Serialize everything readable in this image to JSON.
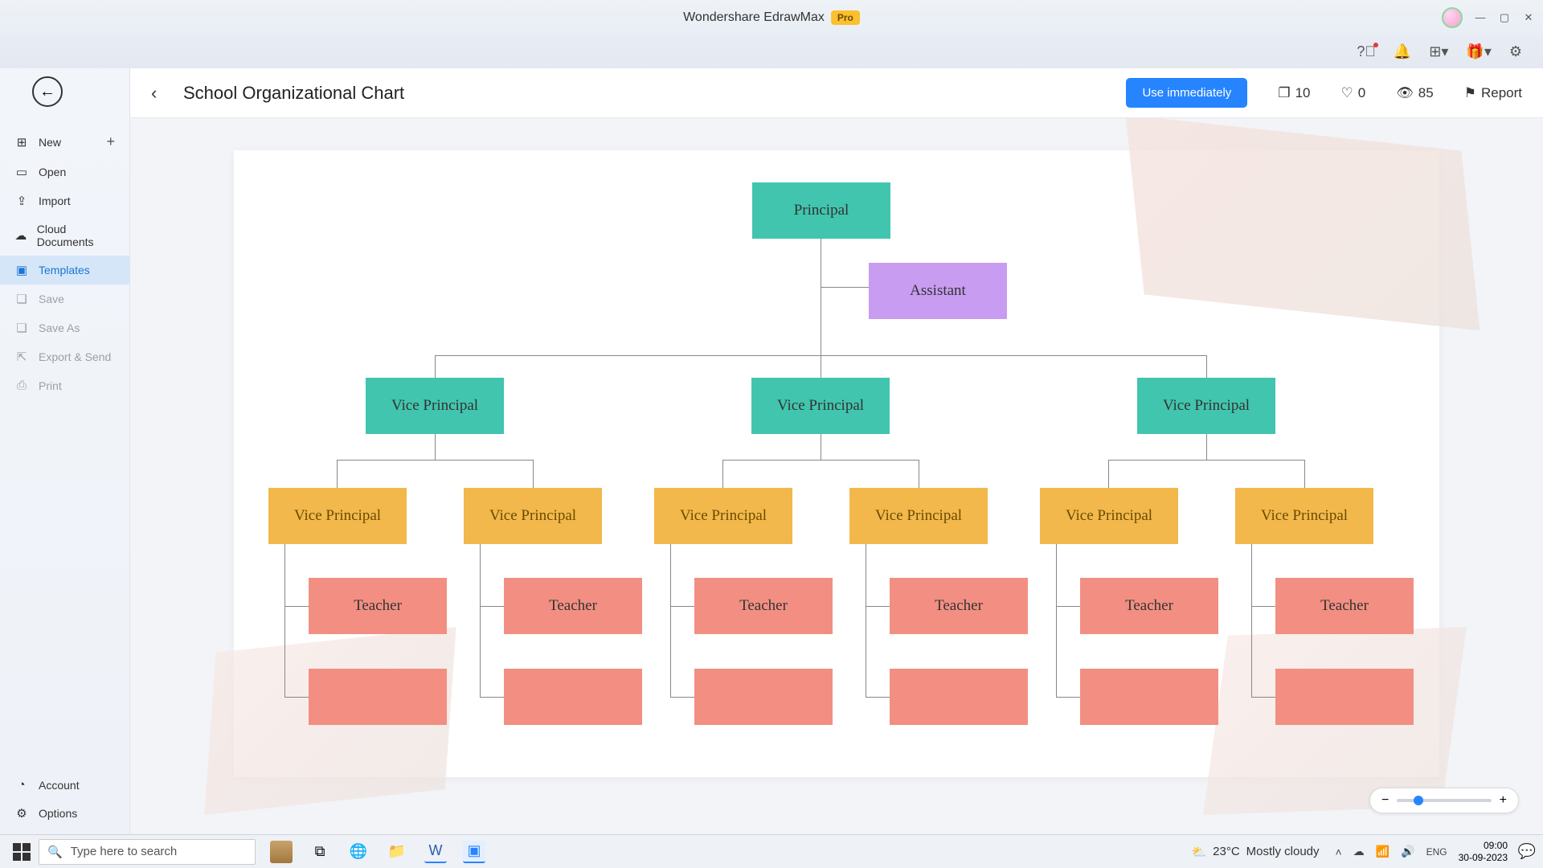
{
  "titlebar": {
    "app": "Wondershare EdrawMax",
    "badge": "Pro"
  },
  "sidebar": {
    "items": [
      {
        "label": "New",
        "icon": "⊞",
        "plus": true
      },
      {
        "label": "Open",
        "icon": "▭"
      },
      {
        "label": "Import",
        "icon": "⇪"
      },
      {
        "label": "Cloud Documents",
        "icon": "☁"
      },
      {
        "label": "Templates",
        "icon": "▣",
        "selected": true
      },
      {
        "label": "Save",
        "icon": "❏",
        "disabled": true
      },
      {
        "label": "Save As",
        "icon": "❏",
        "disabled": true
      },
      {
        "label": "Export & Send",
        "icon": "⇱",
        "disabled": true
      },
      {
        "label": "Print",
        "icon": "⎙",
        "disabled": true
      }
    ],
    "bottom": [
      {
        "label": "Account",
        "icon": "◔"
      },
      {
        "label": "Options",
        "icon": "⚙"
      }
    ]
  },
  "toolbar": {
    "title": "School Organizational Chart",
    "use_btn": "Use immediately",
    "copies": "10",
    "likes": "0",
    "views": "85",
    "report": "Report"
  },
  "chart_data": {
    "type": "tree",
    "title": "School Organizational Chart",
    "root": {
      "label": "Principal",
      "color": "teal",
      "assistant": {
        "label": "Assistant",
        "color": "purple"
      },
      "children": [
        {
          "label": "Vice Principal",
          "color": "teal",
          "children": [
            {
              "label": "Vice Principal",
              "color": "amber",
              "children": [
                {
                  "label": "Teacher",
                  "color": "coral"
                },
                {
                  "label": "",
                  "color": "coral"
                }
              ]
            },
            {
              "label": "Vice Principal",
              "color": "amber",
              "children": [
                {
                  "label": "Teacher",
                  "color": "coral"
                },
                {
                  "label": "",
                  "color": "coral"
                }
              ]
            }
          ]
        },
        {
          "label": "Vice Principal",
          "color": "teal",
          "children": [
            {
              "label": "Vice Principal",
              "color": "amber",
              "children": [
                {
                  "label": "Teacher",
                  "color": "coral"
                },
                {
                  "label": "",
                  "color": "coral"
                }
              ]
            },
            {
              "label": "Vice Principal",
              "color": "amber",
              "children": [
                {
                  "label": "Teacher",
                  "color": "coral"
                },
                {
                  "label": "",
                  "color": "coral"
                }
              ]
            }
          ]
        },
        {
          "label": "Vice Principal",
          "color": "teal",
          "children": [
            {
              "label": "Vice Principal",
              "color": "amber",
              "children": [
                {
                  "label": "Teacher",
                  "color": "coral"
                },
                {
                  "label": "",
                  "color": "coral"
                }
              ]
            },
            {
              "label": "Vice Principal",
              "color": "amber",
              "children": [
                {
                  "label": "Teacher",
                  "color": "coral"
                },
                {
                  "label": "",
                  "color": "coral"
                }
              ]
            }
          ]
        }
      ]
    }
  },
  "taskbar": {
    "search_placeholder": "Type here to search",
    "weather_temp": "23°C",
    "weather_desc": "Mostly cloudy",
    "time": "09:00",
    "date": "30-09-2023"
  }
}
